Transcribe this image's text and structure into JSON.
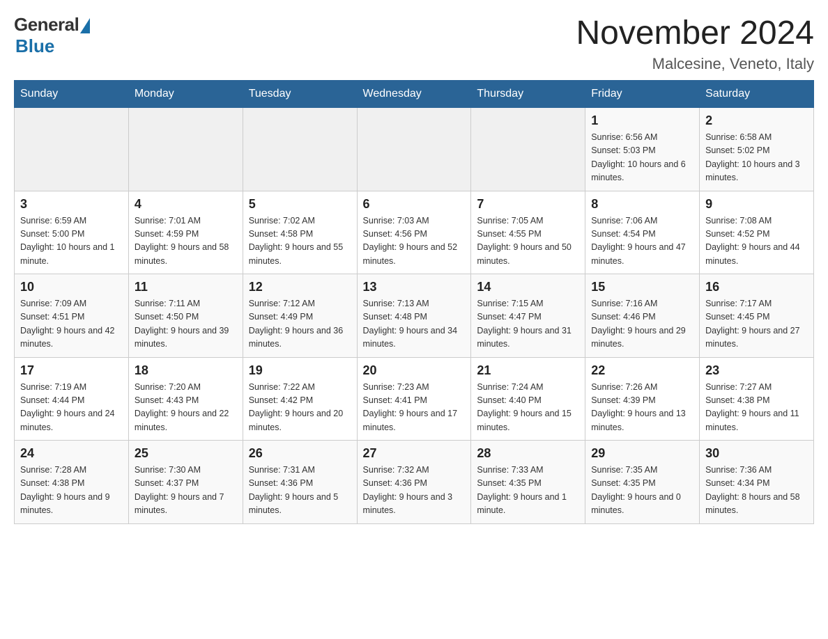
{
  "header": {
    "logo_general": "General",
    "logo_blue": "Blue",
    "month_year": "November 2024",
    "location": "Malcesine, Veneto, Italy"
  },
  "days_of_week": [
    "Sunday",
    "Monday",
    "Tuesday",
    "Wednesday",
    "Thursday",
    "Friday",
    "Saturday"
  ],
  "weeks": [
    [
      {
        "day": "",
        "info": ""
      },
      {
        "day": "",
        "info": ""
      },
      {
        "day": "",
        "info": ""
      },
      {
        "day": "",
        "info": ""
      },
      {
        "day": "",
        "info": ""
      },
      {
        "day": "1",
        "info": "Sunrise: 6:56 AM\nSunset: 5:03 PM\nDaylight: 10 hours and 6 minutes."
      },
      {
        "day": "2",
        "info": "Sunrise: 6:58 AM\nSunset: 5:02 PM\nDaylight: 10 hours and 3 minutes."
      }
    ],
    [
      {
        "day": "3",
        "info": "Sunrise: 6:59 AM\nSunset: 5:00 PM\nDaylight: 10 hours and 1 minute."
      },
      {
        "day": "4",
        "info": "Sunrise: 7:01 AM\nSunset: 4:59 PM\nDaylight: 9 hours and 58 minutes."
      },
      {
        "day": "5",
        "info": "Sunrise: 7:02 AM\nSunset: 4:58 PM\nDaylight: 9 hours and 55 minutes."
      },
      {
        "day": "6",
        "info": "Sunrise: 7:03 AM\nSunset: 4:56 PM\nDaylight: 9 hours and 52 minutes."
      },
      {
        "day": "7",
        "info": "Sunrise: 7:05 AM\nSunset: 4:55 PM\nDaylight: 9 hours and 50 minutes."
      },
      {
        "day": "8",
        "info": "Sunrise: 7:06 AM\nSunset: 4:54 PM\nDaylight: 9 hours and 47 minutes."
      },
      {
        "day": "9",
        "info": "Sunrise: 7:08 AM\nSunset: 4:52 PM\nDaylight: 9 hours and 44 minutes."
      }
    ],
    [
      {
        "day": "10",
        "info": "Sunrise: 7:09 AM\nSunset: 4:51 PM\nDaylight: 9 hours and 42 minutes."
      },
      {
        "day": "11",
        "info": "Sunrise: 7:11 AM\nSunset: 4:50 PM\nDaylight: 9 hours and 39 minutes."
      },
      {
        "day": "12",
        "info": "Sunrise: 7:12 AM\nSunset: 4:49 PM\nDaylight: 9 hours and 36 minutes."
      },
      {
        "day": "13",
        "info": "Sunrise: 7:13 AM\nSunset: 4:48 PM\nDaylight: 9 hours and 34 minutes."
      },
      {
        "day": "14",
        "info": "Sunrise: 7:15 AM\nSunset: 4:47 PM\nDaylight: 9 hours and 31 minutes."
      },
      {
        "day": "15",
        "info": "Sunrise: 7:16 AM\nSunset: 4:46 PM\nDaylight: 9 hours and 29 minutes."
      },
      {
        "day": "16",
        "info": "Sunrise: 7:17 AM\nSunset: 4:45 PM\nDaylight: 9 hours and 27 minutes."
      }
    ],
    [
      {
        "day": "17",
        "info": "Sunrise: 7:19 AM\nSunset: 4:44 PM\nDaylight: 9 hours and 24 minutes."
      },
      {
        "day": "18",
        "info": "Sunrise: 7:20 AM\nSunset: 4:43 PM\nDaylight: 9 hours and 22 minutes."
      },
      {
        "day": "19",
        "info": "Sunrise: 7:22 AM\nSunset: 4:42 PM\nDaylight: 9 hours and 20 minutes."
      },
      {
        "day": "20",
        "info": "Sunrise: 7:23 AM\nSunset: 4:41 PM\nDaylight: 9 hours and 17 minutes."
      },
      {
        "day": "21",
        "info": "Sunrise: 7:24 AM\nSunset: 4:40 PM\nDaylight: 9 hours and 15 minutes."
      },
      {
        "day": "22",
        "info": "Sunrise: 7:26 AM\nSunset: 4:39 PM\nDaylight: 9 hours and 13 minutes."
      },
      {
        "day": "23",
        "info": "Sunrise: 7:27 AM\nSunset: 4:38 PM\nDaylight: 9 hours and 11 minutes."
      }
    ],
    [
      {
        "day": "24",
        "info": "Sunrise: 7:28 AM\nSunset: 4:38 PM\nDaylight: 9 hours and 9 minutes."
      },
      {
        "day": "25",
        "info": "Sunrise: 7:30 AM\nSunset: 4:37 PM\nDaylight: 9 hours and 7 minutes."
      },
      {
        "day": "26",
        "info": "Sunrise: 7:31 AM\nSunset: 4:36 PM\nDaylight: 9 hours and 5 minutes."
      },
      {
        "day": "27",
        "info": "Sunrise: 7:32 AM\nSunset: 4:36 PM\nDaylight: 9 hours and 3 minutes."
      },
      {
        "day": "28",
        "info": "Sunrise: 7:33 AM\nSunset: 4:35 PM\nDaylight: 9 hours and 1 minute."
      },
      {
        "day": "29",
        "info": "Sunrise: 7:35 AM\nSunset: 4:35 PM\nDaylight: 9 hours and 0 minutes."
      },
      {
        "day": "30",
        "info": "Sunrise: 7:36 AM\nSunset: 4:34 PM\nDaylight: 8 hours and 58 minutes."
      }
    ]
  ]
}
